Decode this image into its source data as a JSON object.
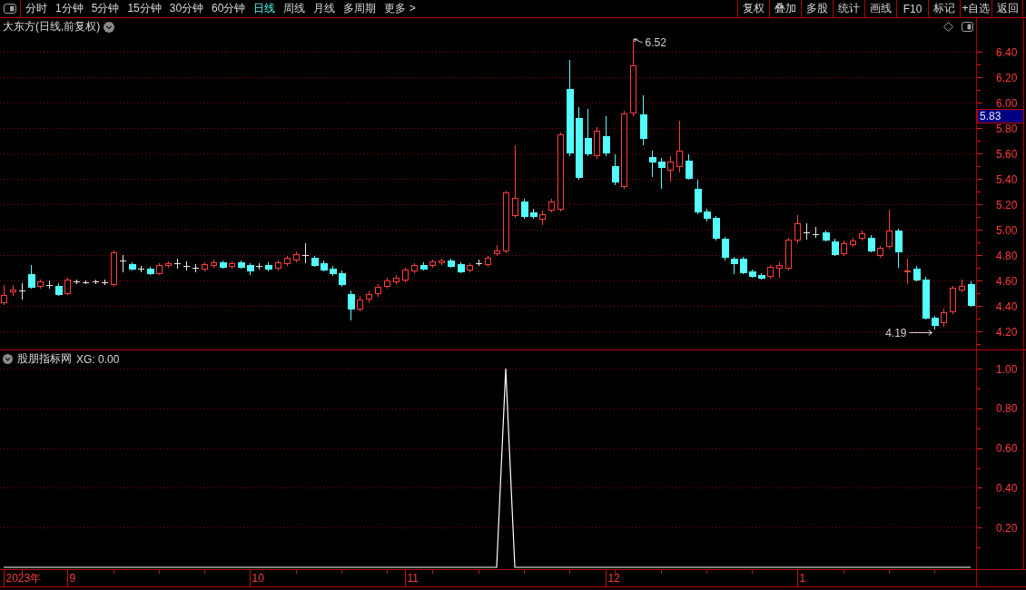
{
  "toolbar": {
    "periods": [
      {
        "label": "分时",
        "selected": false
      },
      {
        "label": "1分钟",
        "selected": false
      },
      {
        "label": "5分钟",
        "selected": false
      },
      {
        "label": "15分钟",
        "selected": false
      },
      {
        "label": "30分钟",
        "selected": false
      },
      {
        "label": "60分钟",
        "selected": false
      },
      {
        "label": "日线",
        "selected": true
      },
      {
        "label": "周线",
        "selected": false
      },
      {
        "label": "月线",
        "selected": false
      },
      {
        "label": "多周期",
        "selected": false
      },
      {
        "label": "更多 >",
        "selected": false
      }
    ],
    "actions": [
      "复权",
      "叠加",
      "多股",
      "统计",
      "画线",
      "F10",
      "标记",
      "+自选",
      "返回"
    ]
  },
  "main_chart": {
    "title": "大东方(日线,前复权)",
    "price_axis": [
      "6.40",
      "6.20",
      "6.00",
      "5.80",
      "5.60",
      "5.40",
      "5.20",
      "5.00",
      "4.80",
      "4.60",
      "4.40",
      "4.20"
    ],
    "current_price": "5.83",
    "high_label": "6.52",
    "low_label": "4.19"
  },
  "indicator": {
    "name": "股朋指标网",
    "reading": "XG: 0.00",
    "chart_data": {
      "type": "line",
      "grid": true,
      "ylim": [
        0,
        1
      ],
      "yticks": [
        {
          "value": 0.2,
          "label": "0.20"
        },
        {
          "value": 0.4,
          "label": "0.40"
        },
        {
          "value": 0.6,
          "label": "0.60"
        },
        {
          "value": 0.8,
          "label": "0.80"
        },
        {
          "value": 1,
          "label": "1.00"
        }
      ],
      "values": [
        0,
        0,
        0,
        0,
        0,
        0,
        0,
        0,
        0,
        0,
        0,
        0,
        0,
        0,
        0,
        0,
        0,
        0,
        0,
        0,
        0,
        0,
        0,
        0,
        0,
        0,
        0,
        0,
        0,
        0,
        0,
        0,
        0,
        0,
        0,
        0,
        0,
        0,
        0,
        0,
        0,
        0,
        0,
        0,
        0,
        0,
        0,
        0,
        0,
        0,
        0,
        0,
        0,
        0,
        0,
        1,
        0,
        0,
        0,
        0,
        0,
        0,
        0,
        0,
        0,
        0,
        0,
        0,
        0,
        0,
        0,
        0,
        0,
        0,
        0,
        0,
        0,
        0,
        0,
        0,
        0,
        0,
        0,
        0,
        0,
        0,
        0,
        0,
        0,
        0,
        0,
        0,
        0,
        0,
        0,
        0,
        0,
        0,
        0,
        0,
        0,
        0,
        0,
        0,
        0,
        0,
        0
      ]
    }
  },
  "date_axis": [
    "2023年",
    "9",
    "10",
    "11",
    "12",
    "1"
  ]
}
